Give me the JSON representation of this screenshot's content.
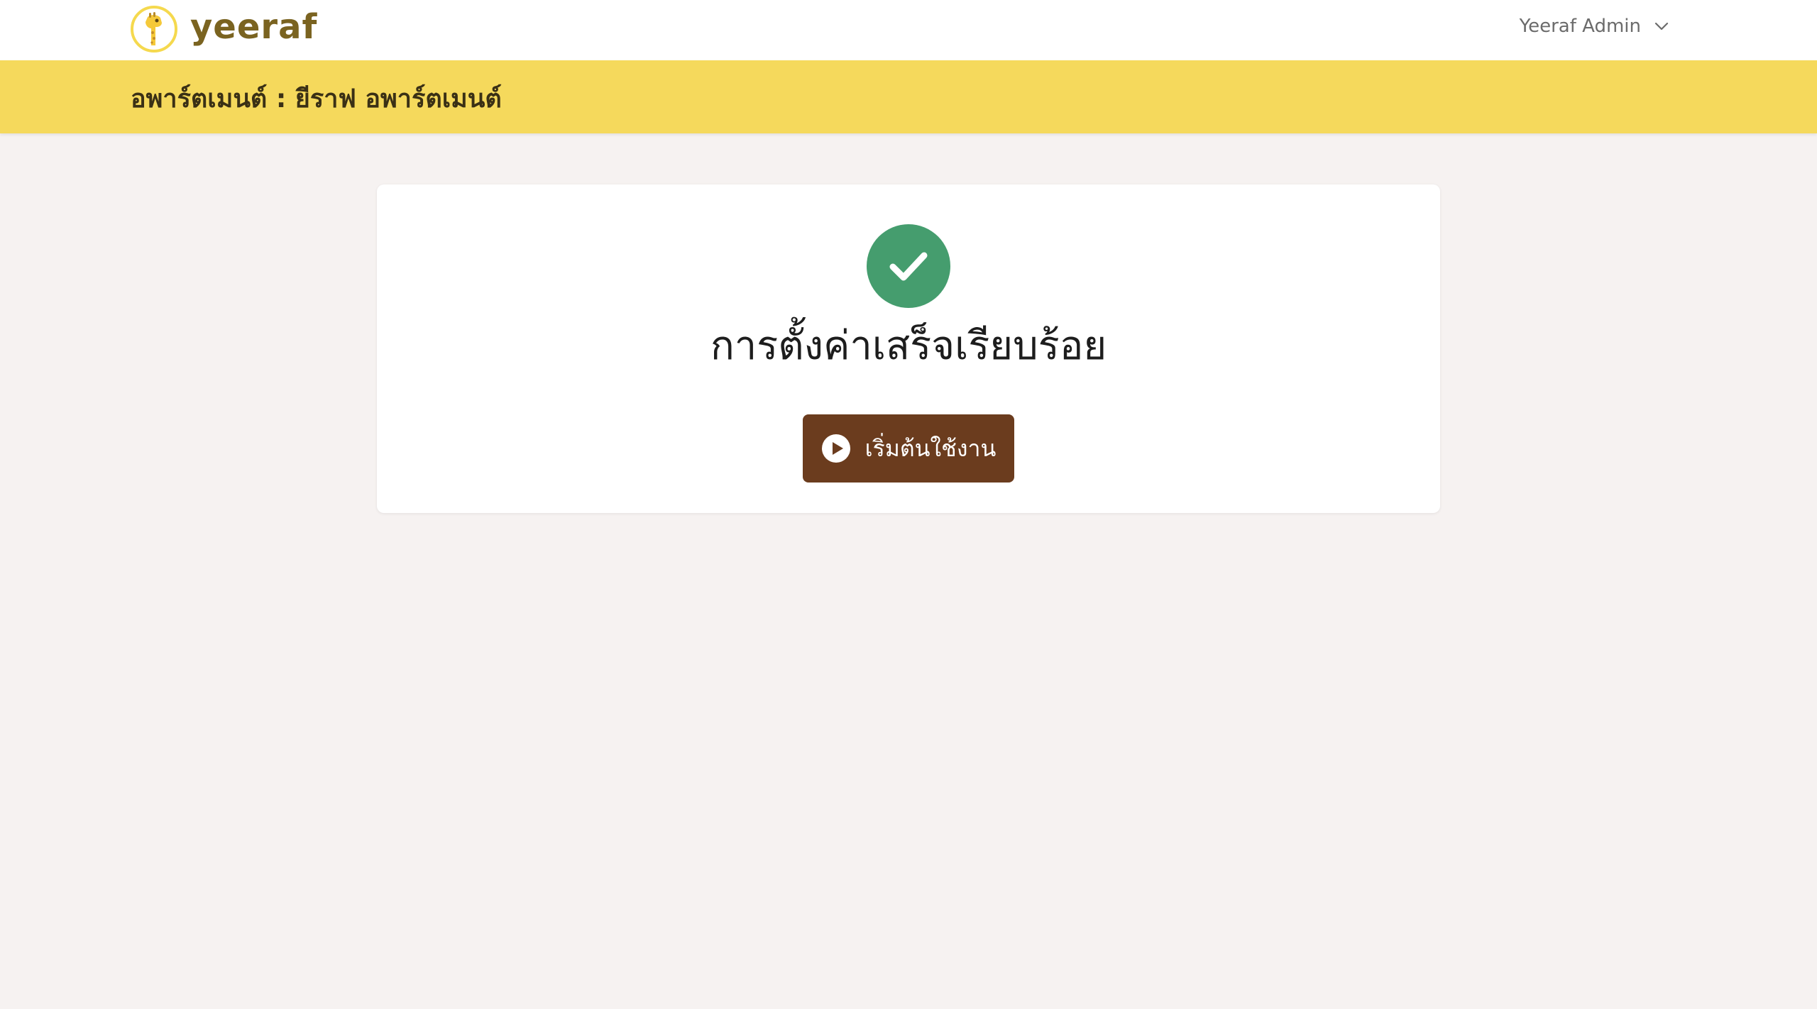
{
  "header": {
    "logo_text": "yeeraf",
    "user_name": "Yeeraf Admin"
  },
  "titlebar": {
    "title": "อพาร์ตเมนต์ : ยีราฟ อพาร์ตเมนต์"
  },
  "card": {
    "title": "การตั้งค่าเสร็จเรียบร้อย",
    "button_label": "เริ่มต้นใช้งาน"
  },
  "icons": {
    "logo": "giraffe-logo-icon",
    "user_menu": "chevron-down-icon",
    "success": "check-circle-icon",
    "button": "play-circle-icon"
  },
  "colors": {
    "brand_yellow": "#f5d95c",
    "brand_brown": "#6b3c1e",
    "logo_text": "#7a6320",
    "success_green": "#459d6e",
    "page_background": "#f6f2f1"
  }
}
